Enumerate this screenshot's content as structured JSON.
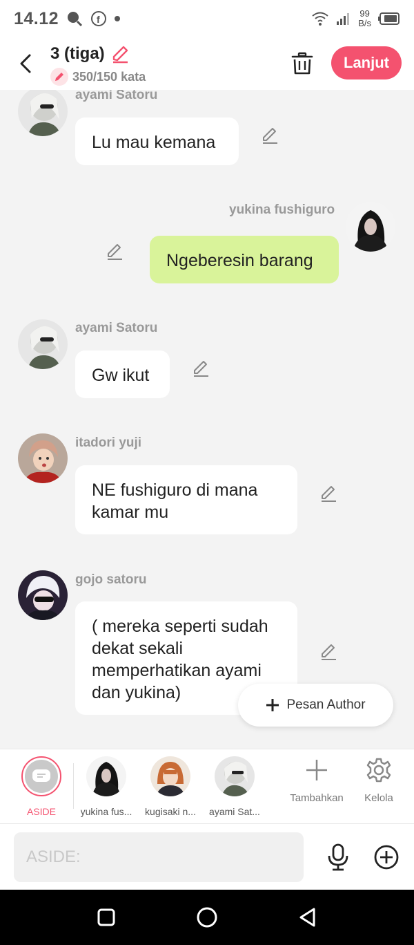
{
  "status_bar": {
    "time": "14.12",
    "net_value": "99",
    "net_unit": "B/s"
  },
  "header": {
    "title": "3 (tiga)",
    "word_count": "350/150 kata",
    "next_label": "Lanjut"
  },
  "messages": [
    {
      "author": "ayami Satoru",
      "text": "Lu mau kemana",
      "side": "left"
    },
    {
      "author": "yukina fushiguro",
      "text": "Ngeberesin barang",
      "side": "right"
    },
    {
      "author": "ayami Satoru",
      "text": "Gw ikut",
      "side": "left"
    },
    {
      "author": "itadori yuji",
      "text": "NE fushiguro di mana kamar mu",
      "side": "left"
    },
    {
      "author": "gojo satoru",
      "text": "( mereka seperti sudah dekat sekali memperhatikan ayami dan yukina)",
      "side": "left"
    }
  ],
  "author_message_button": "Pesan Author",
  "characters": {
    "aside": "ASIDE",
    "items": [
      "yukina fus...",
      "kugisaki n...",
      "ayami Sat..."
    ],
    "add_label": "Tambahkan",
    "manage_label": "Kelola"
  },
  "composer": {
    "placeholder": "ASIDE:"
  },
  "colors": {
    "accent": "#f4526f",
    "bubble_self": "#d9f39a",
    "bubble_other": "#ffffff"
  }
}
